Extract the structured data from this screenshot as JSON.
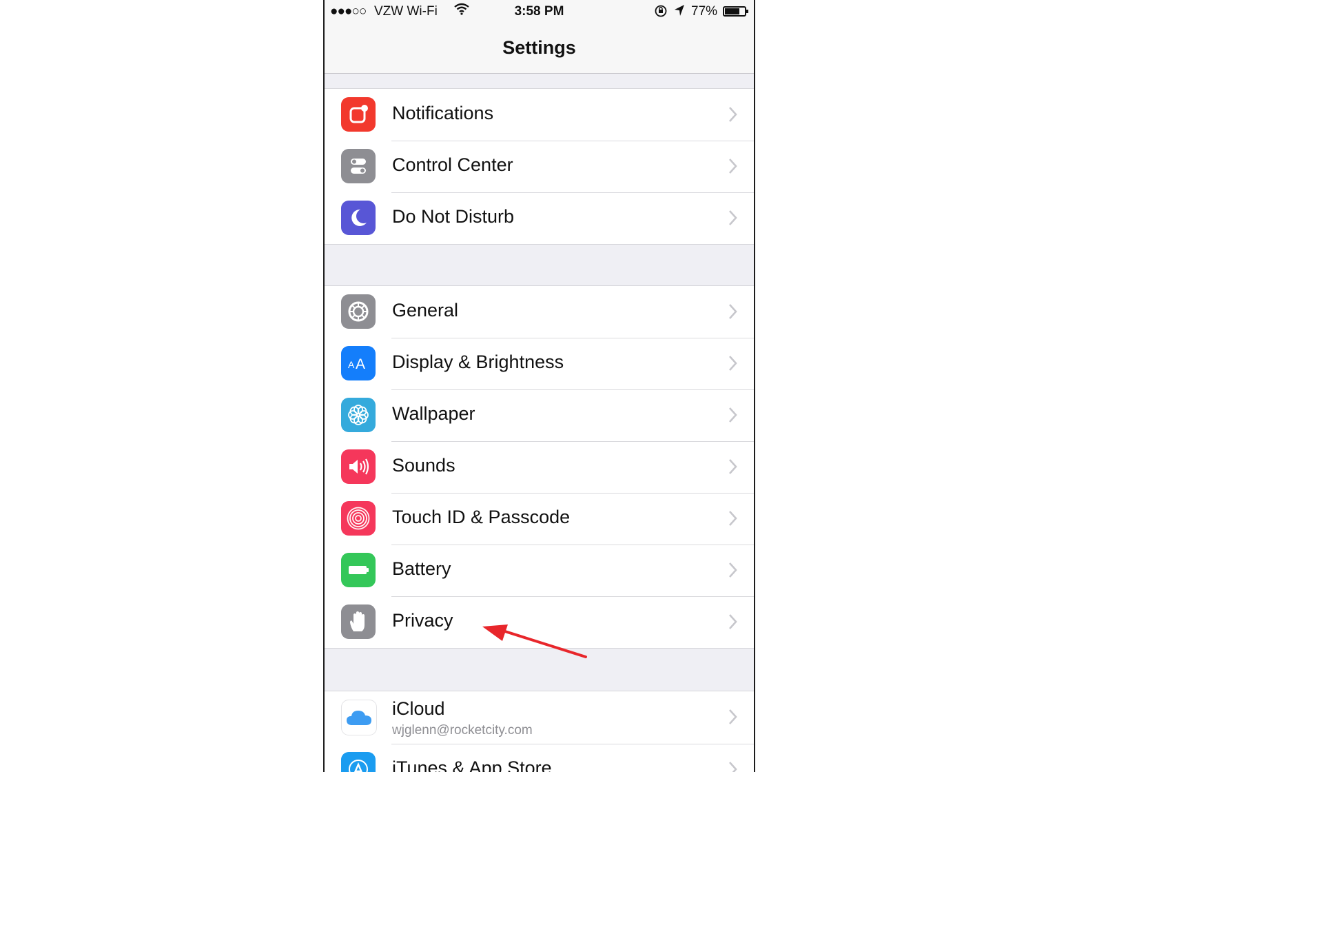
{
  "status_bar": {
    "signal": "●●●○○",
    "carrier": "VZW Wi-Fi",
    "time": "3:58 PM",
    "battery_percent": "77%",
    "battery_level": 0.77
  },
  "nav": {
    "title": "Settings"
  },
  "groups": [
    {
      "items": [
        {
          "label": "Notifications",
          "icon": "notifications-icon",
          "color": "#f2392d"
        },
        {
          "label": "Control Center",
          "icon": "control-center-icon",
          "color": "#8e8e93"
        },
        {
          "label": "Do Not Disturb",
          "icon": "moon-icon",
          "color": "#5856d6"
        }
      ]
    },
    {
      "items": [
        {
          "label": "General",
          "icon": "gear-icon",
          "color": "#8e8e93"
        },
        {
          "label": "Display & Brightness",
          "icon": "display-brightness-icon",
          "color": "#147efb"
        },
        {
          "label": "Wallpaper",
          "icon": "wallpaper-icon",
          "color": "#35aadc"
        },
        {
          "label": "Sounds",
          "icon": "speaker-icon",
          "color": "#f5375b"
        },
        {
          "label": "Touch ID & Passcode",
          "icon": "fingerprint-icon",
          "color": "#f5375b"
        },
        {
          "label": "Battery",
          "icon": "battery-icon",
          "color": "#34c759"
        },
        {
          "label": "Privacy",
          "icon": "hand-icon",
          "color": "#8e8e93"
        }
      ]
    },
    {
      "items": [
        {
          "label": "iCloud",
          "sublabel": "wjglenn@rocketcity.com",
          "icon": "icloud-icon",
          "color": "#ffffff"
        },
        {
          "label": "iTunes & App Store",
          "icon": "app-store-icon",
          "color": "#1a9cf0"
        }
      ]
    }
  ],
  "annotation": {
    "target": "Privacy",
    "color": "#e8262b"
  }
}
